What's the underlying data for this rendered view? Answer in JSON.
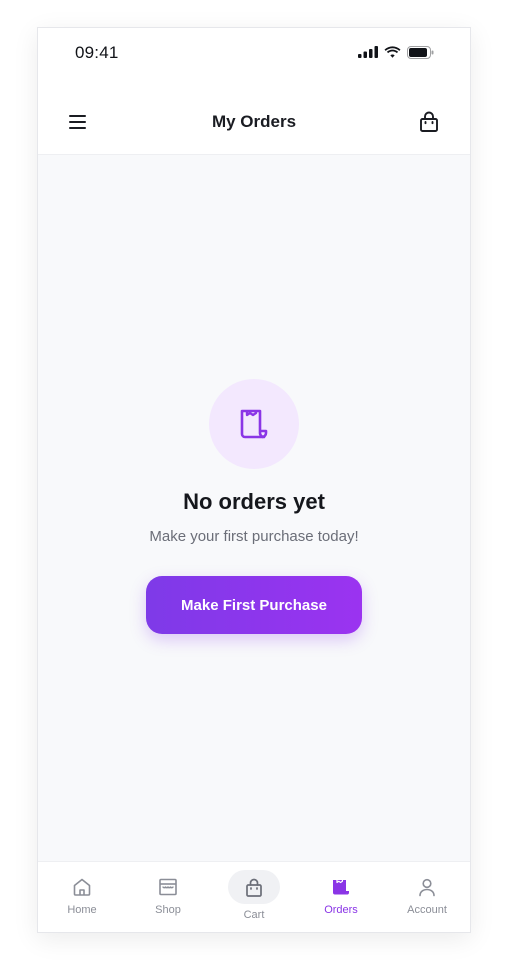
{
  "status_bar": {
    "time": "09:41"
  },
  "header": {
    "title": "My Orders",
    "menu_icon": "hamburger-menu-icon",
    "bag_icon": "shopping-bag-icon"
  },
  "empty_state": {
    "icon": "receipt-icon",
    "title": "No orders yet",
    "subtitle": "Make your first purchase today!",
    "button_label": "Make First Purchase"
  },
  "bottom_nav": {
    "items": [
      {
        "label": "Home",
        "icon": "home-icon",
        "active": false
      },
      {
        "label": "Shop",
        "icon": "storefront-icon",
        "active": false
      },
      {
        "label": "Cart",
        "icon": "bag-icon",
        "active": false
      },
      {
        "label": "Orders",
        "icon": "receipt-icon",
        "active": true
      },
      {
        "label": "Account",
        "icon": "user-icon",
        "active": false
      }
    ]
  },
  "colors": {
    "accent": "#8a35e6",
    "accent_light": "#f3e8fe",
    "background": "#f8f9fb",
    "text_primary": "#15171c",
    "text_secondary": "#6b6e78",
    "nav_inactive": "#8b8e97"
  }
}
